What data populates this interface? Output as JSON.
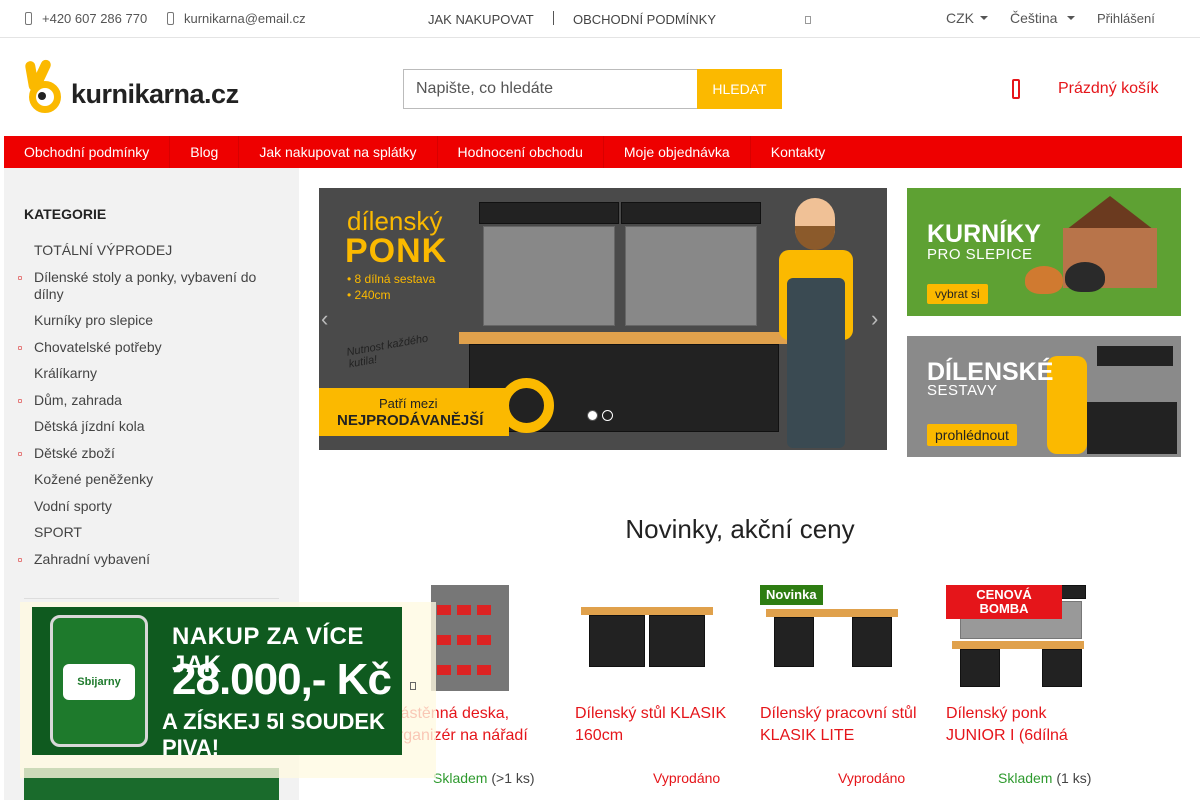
{
  "topbar": {
    "phone": "+420 607 286 770",
    "email": "kurnikarna@email.cz",
    "link_how_to_buy": "JAK NAKUPOVAT",
    "link_terms": "OBCHODNÍ PODMÍNKY",
    "currency": "CZK",
    "language": "Čeština",
    "login": "Přihlášení"
  },
  "header": {
    "logo_text": "kurnikarna.cz",
    "search_placeholder": "Napište, co hledáte",
    "search_button": "HLEDAT",
    "cart_label": "Prázdný košík"
  },
  "nav": [
    "Obchodní podmínky",
    "Blog",
    "Jak nakupovat na splátky",
    "Hodnocení obchodu",
    "Moje objednávka",
    "Kontakty"
  ],
  "sidebar": {
    "title": "KATEGORIE",
    "categories": [
      {
        "label": "TOTÁLNÍ VÝPRODEJ",
        "has_sub": false
      },
      {
        "label": "Dílenské stoly a ponky, vybavení do dílny",
        "has_sub": true
      },
      {
        "label": "Kurníky pro slepice",
        "has_sub": false
      },
      {
        "label": "Chovatelské potřeby",
        "has_sub": true
      },
      {
        "label": "Králíkarny",
        "has_sub": false
      },
      {
        "label": "Dům, zahrada",
        "has_sub": true
      },
      {
        "label": "Dětská jízdní kola",
        "has_sub": false
      },
      {
        "label": "Dětské zboží",
        "has_sub": true
      },
      {
        "label": "Kožené peněženky",
        "has_sub": false
      },
      {
        "label": "Vodní sporty",
        "has_sub": false
      },
      {
        "label": "SPORT",
        "has_sub": false
      },
      {
        "label": "Zahradní vybavení",
        "has_sub": true
      }
    ]
  },
  "slider": {
    "title_line1": "dílenský",
    "title_line2": "PONK",
    "bullet1": "•  8 dílná sestava",
    "bullet2": "•  240cm",
    "scribble": "Nutnost každého kutila!",
    "badge_line1": "Patří mezi",
    "badge_line2": "NEJPRODÁVANĚJŠÍ",
    "prev_arrow": "‹",
    "next_arrow": "›",
    "slide_count": 2,
    "active_slide": 1
  },
  "banners": [
    {
      "title": "KURNÍKY",
      "subtitle": "PRO SLEPICE",
      "button": "vybrat si"
    },
    {
      "title": "DÍLENSKÉ",
      "subtitle": "SESTAVY",
      "button": "prohlédnout"
    }
  ],
  "section_title": "Novinky, akční ceny",
  "products": [
    {
      "name": "Nástěnná deska, organizér na nářadí",
      "tag": "",
      "stock_status": "Skladem",
      "stock_count": "(>1 ks)",
      "in_stock": true
    },
    {
      "name": "Dílenský stůl KLASIK 160cm",
      "tag": "",
      "stock_status": "Vyprodáno",
      "stock_count": "",
      "in_stock": false
    },
    {
      "name": "Dílenský pracovní stůl KLASIK LITE",
      "tag": "Novinka",
      "stock_status": "Vyprodáno",
      "stock_count": "",
      "in_stock": false
    },
    {
      "name": "Dílenský ponk JUNIOR I (6dílná",
      "tag": "CENOVÁ BOMBA",
      "stock_status": "Skladem",
      "stock_count": "(1 ks)",
      "in_stock": true
    }
  ],
  "popup": {
    "line1": "NAKUP ZA VÍCE JAK",
    "line2": "28.000,- Kč",
    "line3": "A ZÍSKEJ 5l SOUDEK PIVA!",
    "keg_label": "Sbijarny"
  }
}
